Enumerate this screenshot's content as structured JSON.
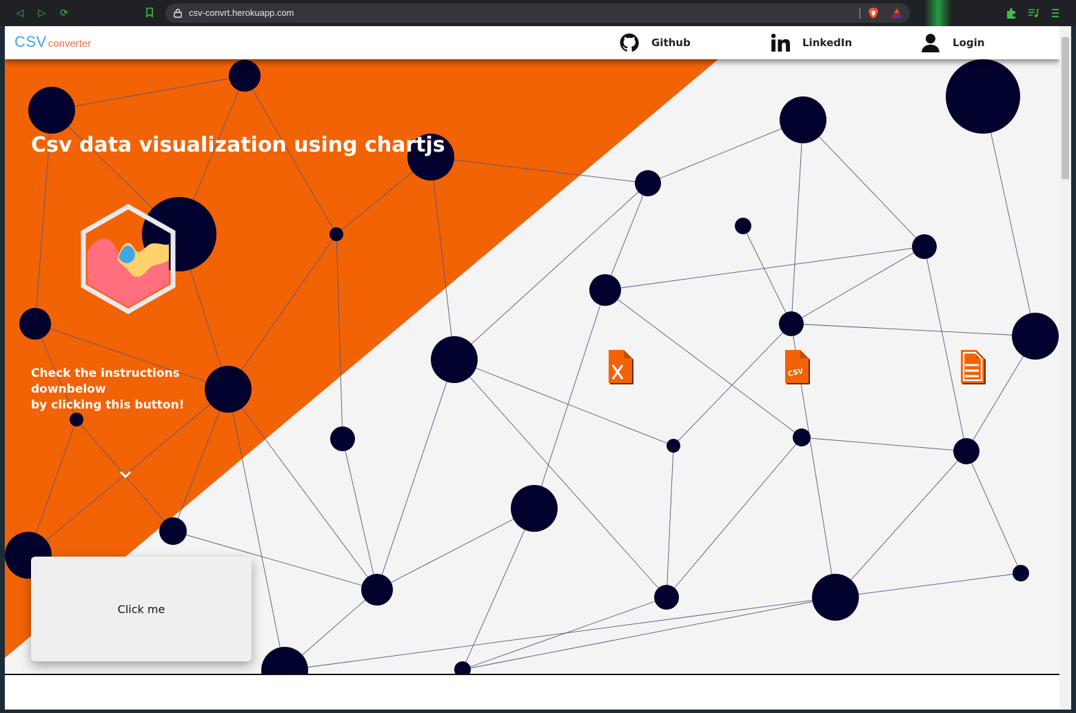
{
  "browser": {
    "url": "csv-convrt.herokuapp.com"
  },
  "navbar": {
    "logo_main": "CSV",
    "logo_sub": "converter",
    "links": [
      {
        "label": "Github",
        "icon": "github-icon"
      },
      {
        "label": "LinkedIn",
        "icon": "linkedin-icon"
      },
      {
        "label": "Login",
        "icon": "user-icon"
      }
    ]
  },
  "hero": {
    "title": "Csv data visualization using chartjs",
    "instructions": "Check the instructions downbelow by clicking this button!",
    "instructions_lines": [
      "Check the instructions",
      "downbelow",
      "by clicking this button!"
    ],
    "card_button": "Click me"
  },
  "file_icons": [
    "excel-file-icon",
    "csv-file-icon",
    "text-file-icon"
  ],
  "colors": {
    "orange": "#f26306",
    "node": "#02022e",
    "background": "#f4f4f4",
    "logo_blue": "#3ea6e8",
    "logo_orange": "#f56b3f"
  }
}
